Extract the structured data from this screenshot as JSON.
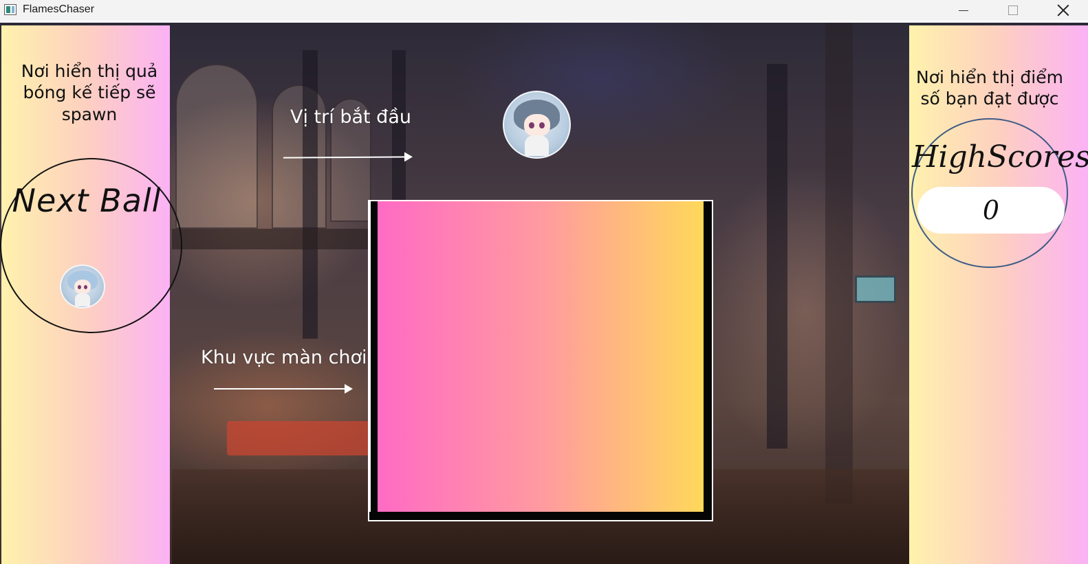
{
  "window": {
    "title": "FlamesChaser"
  },
  "left_panel": {
    "caption": "Nơi hiển thị quả bóng kế tiếp sẽ spawn",
    "next_ball_label": "Next Ball"
  },
  "right_panel": {
    "caption": "Nơi hiển thị điểm số bạn đạt được",
    "highscore_label": "HighScores",
    "score_value": "0"
  },
  "annotations": {
    "start_position": "Vị trí bắt đầu",
    "play_area": "Khu vực màn chơi"
  },
  "colors": {
    "panel_gradient": [
      "#fff2ad",
      "#fdd0c0",
      "#fbb2f5"
    ],
    "play_area_gradient": [
      "#ff6bc4",
      "#ff9aa0",
      "#ffd85a"
    ],
    "right_ring": "#3e5c86",
    "annotation_text": "#ffffff"
  },
  "icons": {
    "app": "app-window-icon",
    "minimize": "minimize-icon",
    "maximize": "maximize-icon",
    "close": "close-icon"
  }
}
